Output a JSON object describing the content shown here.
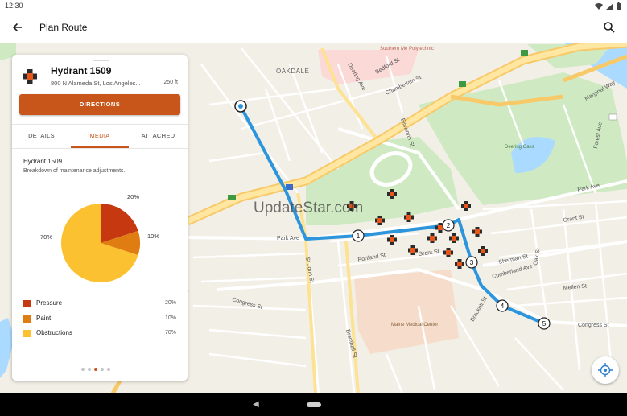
{
  "status": {
    "time": "12:30"
  },
  "app": {
    "title": "Plan Route"
  },
  "map": {
    "watermark": "UpdateStar.com",
    "labels": {
      "oakdale": "OAKDALE",
      "southern_me": "Southern Me Polytechnic",
      "deering_ave": "Deering Ave",
      "bedford_st": "Bedford St",
      "chamberlain": "Chamberlain St",
      "park_ave": "Park Ave",
      "park_ave2": "Park Ave",
      "congress_st": "Congress St",
      "congress_st2": "Congress St",
      "cumberland": "Cumberland Ave",
      "grant_st": "Grant St",
      "sherman": "Sherman St",
      "deering_oaks": "Deering Oaks",
      "maine_medical": "Maine Medical Center",
      "marginal_way": "Marginal Way",
      "forest_ave": "Forest Ave",
      "st_john": "St John St",
      "bramhall": "Bramhall St",
      "brackett": "Brackett St",
      "grant_st2": "Grant St",
      "ellsworth": "Ellsworth St",
      "portland": "Portland St",
      "oak_st": "Oak St",
      "mellen": "Mellen St"
    },
    "route_stops": [
      "1",
      "2",
      "3",
      "4",
      "5"
    ]
  },
  "panel": {
    "title": "Hydrant 1509",
    "address": "800 N Alameda St, Los Angeles...",
    "distance": "250 ft",
    "directions_label": "DIRECTIONS",
    "tabs": [
      "DETAILS",
      "MEDIA",
      "ATTACHED"
    ],
    "active_tab": "MEDIA",
    "media_title": "Hydrant 1509",
    "media_subtitle": "Breakdown of maintenance adjustments.",
    "pager": {
      "count": 5,
      "active": 2
    }
  },
  "chart_data": {
    "type": "pie",
    "title": "",
    "slices": [
      {
        "label": "Pressure",
        "value": 20,
        "value_label": "20%",
        "color": "#c6380f"
      },
      {
        "label": "Paint",
        "value": 10,
        "value_label": "10%",
        "color": "#e07d12"
      },
      {
        "label": "Obstructions",
        "value": 70,
        "value_label": "70%",
        "color": "#fcc131"
      }
    ],
    "legend_position": "bottom"
  },
  "colors": {
    "accent": "#c8561a",
    "route": "#2d95dc"
  },
  "icons": {
    "back": "arrow-left-icon",
    "search": "search-icon",
    "locate": "my-location-icon",
    "hydrant": "hydrant-marker-icon"
  }
}
